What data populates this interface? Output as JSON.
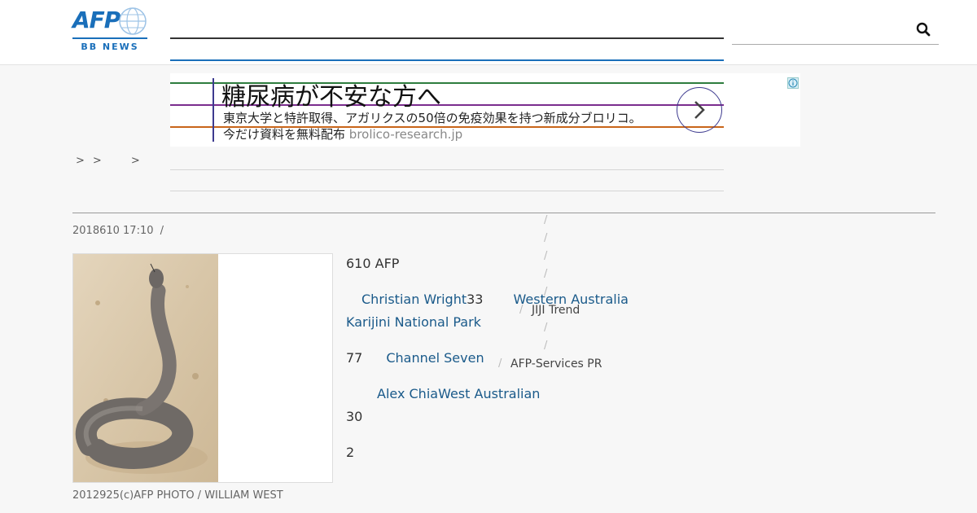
{
  "header": {
    "logo_text": "AFP",
    "logo_subtext": "BB NEWS",
    "search": {
      "value": "",
      "placeholder": ""
    }
  },
  "ad": {
    "headline": "糖尿病が不安な方へ",
    "description_line1": "東京大学と特許取得、アガリクスの50倍の免疫効果を持つ新成分ブロリコ。",
    "description_line2": "今だけ資料を無料配布",
    "domain": "brolico-research.jp",
    "line_colors": [
      "#2e7d3e",
      "#7b2d8e",
      "#c9651a"
    ]
  },
  "breadcrumb": {
    "sep1": ">",
    "sep2": ">",
    "sep3": ">"
  },
  "article": {
    "title": "",
    "meta": {
      "date": "2018610 17:10",
      "separator": "/"
    },
    "caption": "2012925(c)AFP PHOTO / WILLIAM WEST",
    "paragraphs": [
      {
        "text_before": "610 AFP"
      },
      {
        "link1": "Christian Wright",
        "mid": "33",
        "link2": "Western Australia",
        "line2_link": "Karijini National Park"
      },
      {
        "text_before": "77",
        "link": "Channel Seven"
      },
      {
        "link": "Alex Chia",
        "link2": "West Australian"
      },
      {
        "text_before": "30"
      },
      {
        "text_before": "2"
      }
    ]
  },
  "sidebar": {
    "separator": "/",
    "label1": "JIJI Trend",
    "label2": "AFP-Services PR"
  }
}
